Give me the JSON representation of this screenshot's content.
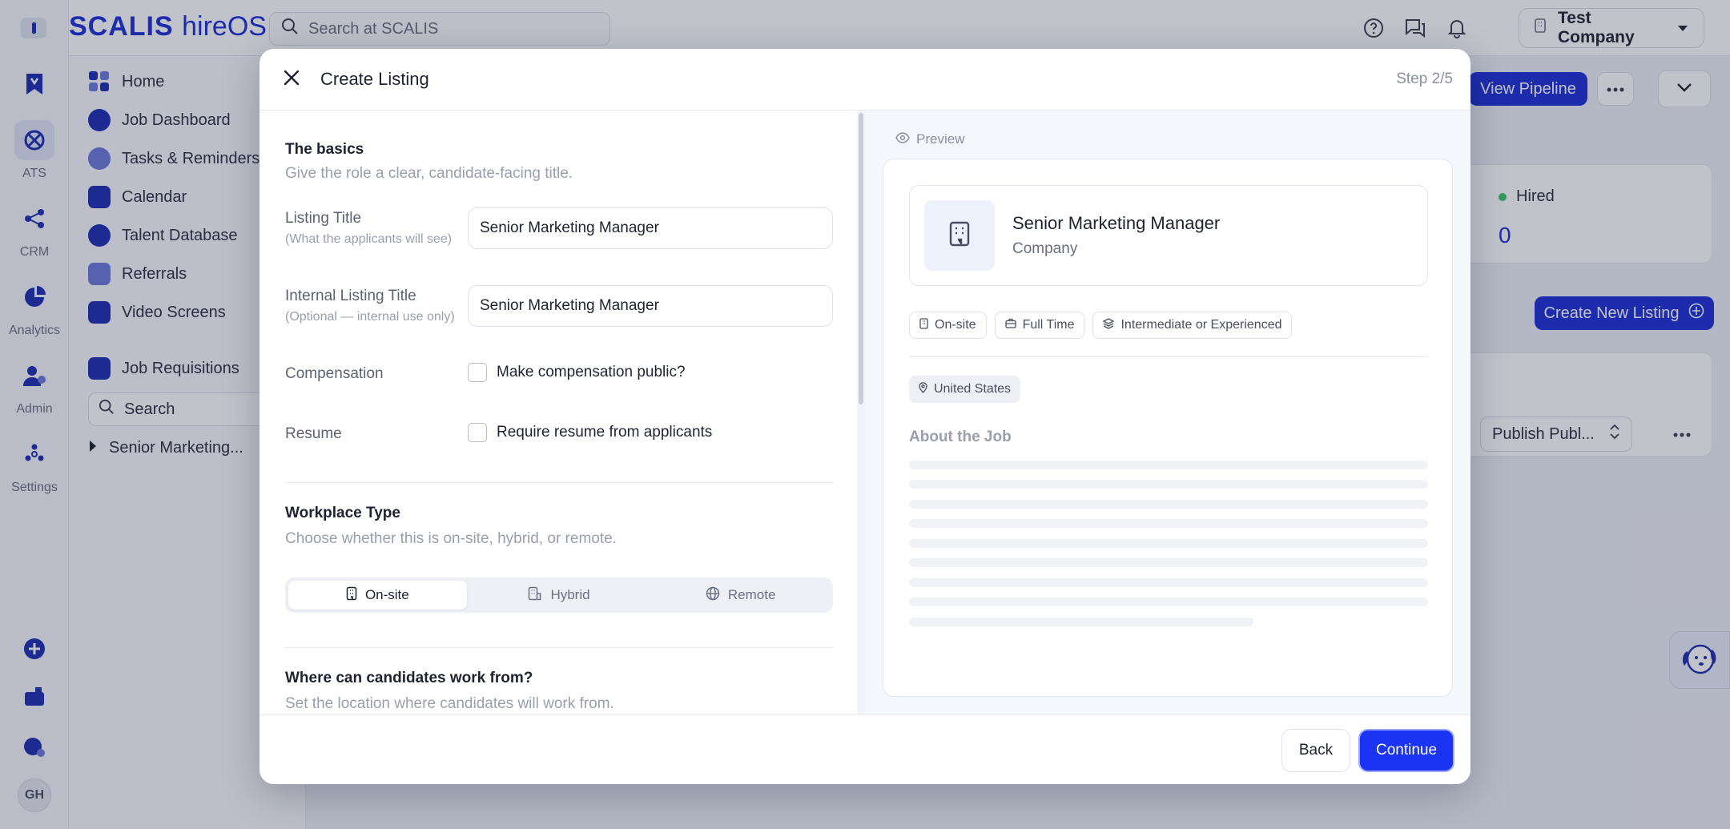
{
  "app": {
    "logo_brand": "SCALIS",
    "logo_product": "hireOS",
    "search_placeholder": "Search at SCALIS",
    "company_name": "Test Company"
  },
  "rail": {
    "items": [
      {
        "label": "ATS"
      },
      {
        "label": "CRM"
      },
      {
        "label": "Analytics"
      },
      {
        "label": "Admin"
      },
      {
        "label": "Settings"
      }
    ],
    "avatar_initials": "GH"
  },
  "sidebar": {
    "items": [
      {
        "label": "Home"
      },
      {
        "label": "Job Dashboard"
      },
      {
        "label": "Tasks & Reminders"
      },
      {
        "label": "Calendar"
      },
      {
        "label": "Talent Database"
      },
      {
        "label": "Referrals"
      },
      {
        "label": "Video Screens"
      }
    ],
    "job_requisitions": "Job Requisitions",
    "search_label": "Search",
    "tree_item": "Senior Marketing..."
  },
  "background": {
    "view_pipeline": "View Pipeline",
    "hired_label": "Hired",
    "hired_value": "0",
    "create_new_listing": "Create New Listing",
    "publish_select": "Publish Publ..."
  },
  "modal": {
    "title": "Create Listing",
    "step": "Step 2/5",
    "basics": {
      "title": "The basics",
      "subtitle": "Give the role a clear, candidate-facing title."
    },
    "listing_title": {
      "label": "Listing Title",
      "hint": "(What the applicants will see)",
      "value": "Senior Marketing Manager"
    },
    "internal_title": {
      "label": "Internal Listing Title",
      "hint": "(Optional — internal use only)",
      "value": "Senior Marketing Manager"
    },
    "compensation": {
      "label": "Compensation",
      "checkbox": "Make compensation public?"
    },
    "resume": {
      "label": "Resume",
      "checkbox": "Require resume from applicants"
    },
    "workplace": {
      "title": "Workplace Type",
      "subtitle": "Choose whether this is on-site, hybrid, or remote.",
      "options": [
        "On-site",
        "Hybrid",
        "Remote"
      ],
      "selected": "On-site"
    },
    "location": {
      "title": "Where can candidates work from?",
      "subtitle": "Set the location where candidates will work from."
    },
    "preview": {
      "label": "Preview",
      "job_title": "Senior Marketing Manager",
      "company": "Company",
      "tags": [
        "On-site",
        "Full Time",
        "Intermediate or Experienced"
      ],
      "location": "United States",
      "about_title": "About the Job"
    },
    "back": "Back",
    "continue": "Continue"
  },
  "colors": {
    "brand": "#1d2fd6",
    "continue": "#1b33f2",
    "hired_dot": "#3cc469"
  }
}
